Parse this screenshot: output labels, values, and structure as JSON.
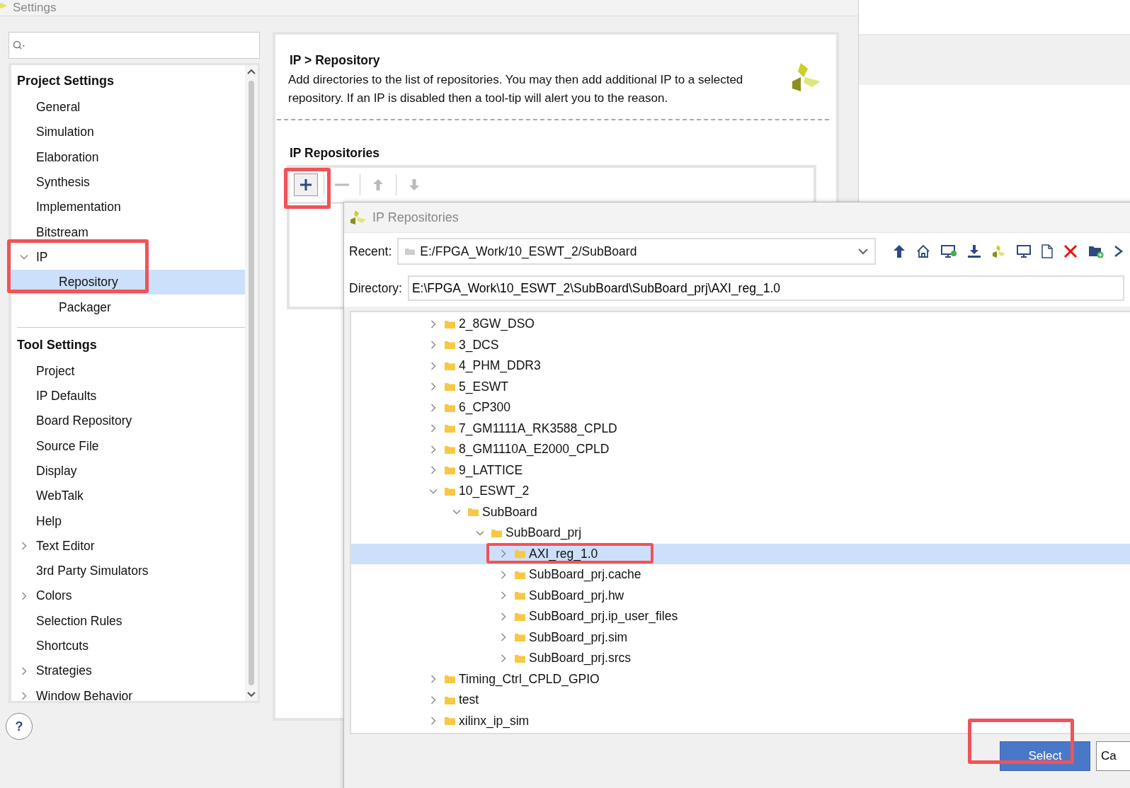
{
  "window": {
    "title": "Settings"
  },
  "sidebar": {
    "sections": [
      {
        "title": "Project Settings",
        "items": [
          {
            "label": "General",
            "selected": false
          },
          {
            "label": "Simulation",
            "selected": false
          },
          {
            "label": "Elaboration",
            "selected": false
          },
          {
            "label": "Synthesis",
            "selected": false
          },
          {
            "label": "Implementation",
            "selected": false
          },
          {
            "label": "Bitstream",
            "selected": false
          },
          {
            "label": "IP",
            "selected": false,
            "expanded": true,
            "highlighted": true,
            "children": [
              {
                "label": "Repository",
                "selected": true
              },
              {
                "label": "Packager",
                "selected": false
              }
            ]
          }
        ]
      },
      {
        "title": "Tool Settings",
        "items": [
          {
            "label": "Project",
            "selected": false
          },
          {
            "label": "IP Defaults",
            "selected": false
          },
          {
            "label": "Board Repository",
            "selected": false
          },
          {
            "label": "Source File",
            "selected": false
          },
          {
            "label": "Display",
            "selected": false
          },
          {
            "label": "WebTalk",
            "selected": false
          },
          {
            "label": "Help",
            "selected": false
          },
          {
            "label": "Text Editor",
            "selected": false,
            "expanded": false
          },
          {
            "label": "3rd Party Simulators",
            "selected": false
          },
          {
            "label": "Colors",
            "selected": false,
            "expanded": false
          },
          {
            "label": "Selection Rules",
            "selected": false
          },
          {
            "label": "Shortcuts",
            "selected": false
          },
          {
            "label": "Strategies",
            "selected": false,
            "expanded": false
          },
          {
            "label": "Window Behavior",
            "selected": false,
            "expanded": false
          }
        ]
      }
    ]
  },
  "help_button": "?",
  "page": {
    "breadcrumb": "IP > Repository",
    "description": "Add directories to the list of repositories. You may then add additional IP to a selected repository. If an IP is disabled then a tool-tip will alert you to the reason.",
    "section_title": "IP Repositories",
    "toolbar": [
      {
        "kind": "add",
        "disabled": false,
        "highlighted": true
      },
      {
        "kind": "remove",
        "disabled": true
      },
      {
        "kind": "up",
        "disabled": true
      },
      {
        "kind": "down",
        "disabled": true
      }
    ]
  },
  "dialog": {
    "title": "IP Repositories",
    "recent_label": "Recent:",
    "recent_value": "E:/FPGA_Work/10_ESWT_2/SubBoard",
    "directory_label": "Directory:",
    "directory_value": "E:\\FPGA_Work\\10_ESWT_2\\SubBoard\\SubBoard_prj\\AXI_reg_1.0",
    "tree": [
      {
        "name": "2_8GW_DSO",
        "expanded": false,
        "selected": false
      },
      {
        "name": "3_DCS",
        "expanded": false,
        "selected": false
      },
      {
        "name": "4_PHM_DDR3",
        "expanded": false,
        "selected": false
      },
      {
        "name": "5_ESWT",
        "expanded": false,
        "selected": false
      },
      {
        "name": "6_CP300",
        "expanded": false,
        "selected": false
      },
      {
        "name": "7_GM1111A_RK3588_CPLD",
        "expanded": false,
        "selected": false
      },
      {
        "name": "8_GM1110A_E2000_CPLD",
        "expanded": false,
        "selected": false
      },
      {
        "name": "9_LATTICE",
        "expanded": false,
        "selected": false
      },
      {
        "name": "10_ESWT_2",
        "expanded": true,
        "selected": false,
        "children": [
          {
            "name": "SubBoard",
            "expanded": true,
            "selected": false,
            "children": [
              {
                "name": "SubBoard_prj",
                "expanded": true,
                "selected": false,
                "children": [
                  {
                    "name": "AXI_reg_1.0",
                    "expanded": false,
                    "selected": true,
                    "highlighted": true
                  },
                  {
                    "name": "SubBoard_prj.cache",
                    "expanded": false,
                    "selected": false
                  },
                  {
                    "name": "SubBoard_prj.hw",
                    "expanded": false,
                    "selected": false
                  },
                  {
                    "name": "SubBoard_prj.ip_user_files",
                    "expanded": false,
                    "selected": false
                  },
                  {
                    "name": "SubBoard_prj.sim",
                    "expanded": false,
                    "selected": false
                  },
                  {
                    "name": "SubBoard_prj.srcs",
                    "expanded": false,
                    "selected": false
                  }
                ]
              }
            ]
          }
        ]
      },
      {
        "name": "Timing_Ctrl_CPLD_GPIO",
        "expanded": false,
        "selected": false
      },
      {
        "name": "test",
        "expanded": false,
        "selected": false
      },
      {
        "name": "xilinx_ip_sim",
        "expanded": false,
        "selected": false
      }
    ],
    "buttons": [
      {
        "label": "Select",
        "kind": "primary",
        "highlighted": true
      },
      {
        "label": "Ca",
        "kind": "secondary",
        "highlighted": false
      }
    ]
  }
}
